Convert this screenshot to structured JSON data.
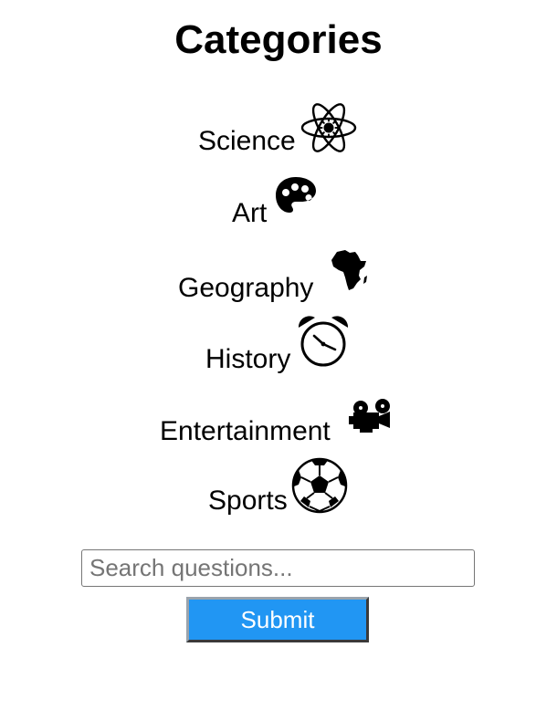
{
  "page_title": "Categories",
  "categories": [
    {
      "label": "Science",
      "icon": "atom-icon"
    },
    {
      "label": "Art",
      "icon": "palette-icon"
    },
    {
      "label": "Geography",
      "icon": "africa-icon"
    },
    {
      "label": "History",
      "icon": "alarm-clock-icon"
    },
    {
      "label": "Entertainment",
      "icon": "film-projector-icon"
    },
    {
      "label": "Sports",
      "icon": "soccer-ball-icon"
    }
  ],
  "search": {
    "placeholder": "Search questions...",
    "value": ""
  },
  "submit_label": "Submit",
  "colors": {
    "accent": "#2196f3",
    "text": "#000000",
    "background": "#ffffff"
  }
}
